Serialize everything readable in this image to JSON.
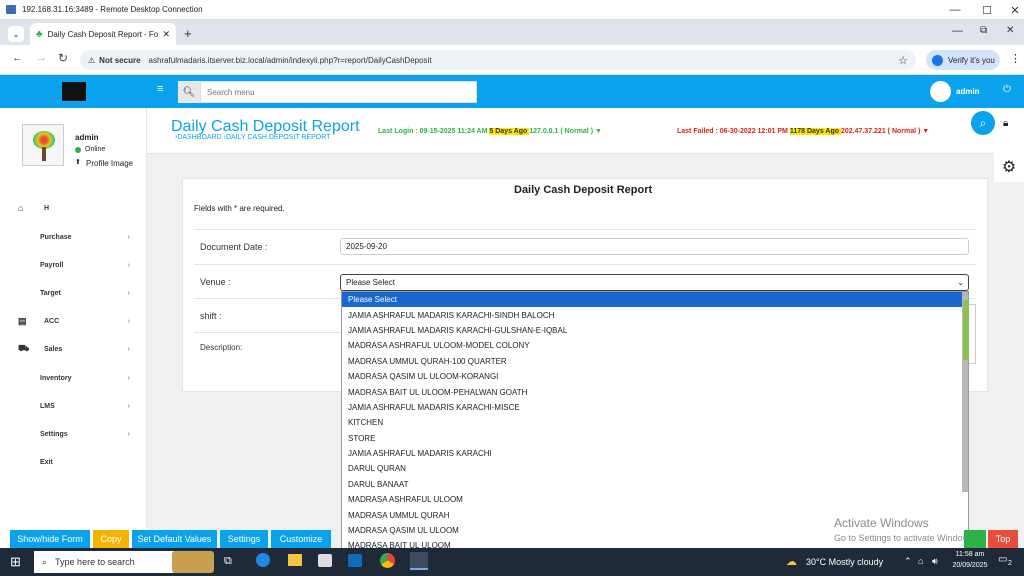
{
  "rdp": {
    "title": "192.168.31.16:3489 - Remote Desktop Connection"
  },
  "browser": {
    "tab_title": "Daily Cash Deposit Report - Fo",
    "not_secure": "Not secure",
    "url": "ashrafulmadaris.itserver.biz.local/admin/indexyii.php?r=report/DailyCashDeposit",
    "verify_label": "Verify it's you"
  },
  "topbar": {
    "search_placeholder": "Search menu",
    "user": "admin"
  },
  "profile": {
    "name": "admin",
    "status": "Online",
    "profile_image": "Profile Image"
  },
  "nav": [
    "H",
    "Purchase",
    "Payroll",
    "Target",
    "ACC",
    "Sales",
    "Inventory",
    "LMS",
    "Settings",
    "Exit"
  ],
  "header": {
    "title": "Daily Cash Deposit Report",
    "breadcrumb": "›DASHBOARD  ›DAILY CASH DEPOSIT REPORT",
    "last_login": "Last Login : 09-15-2025 11:24 AM",
    "last_login_ago": " 5 Days Ago ",
    "last_login_ip": "127.0.0.1 ( Normal ) ▼",
    "last_failed": "Last Failed : 06-30-2022 12:01 PM",
    "last_failed_ago": " 1178 Days Ago ",
    "last_failed_ip": "202.47.37.221 ( Normal ) ▼"
  },
  "form": {
    "title": "Daily Cash Deposit Report",
    "required_note": "Fields with * are required.",
    "doc_date_label": "Document Date :",
    "doc_date_value": "2025-09-20",
    "venue_label": "Venue :",
    "venue_value": "Please Select",
    "shift_label": "shift :",
    "description_label": "Description:"
  },
  "venue_options": [
    "Please Select",
    "JAMIA ASHRAFUL MADARIS KARACHI-SINDH BALOCH",
    "JAMIA ASHRAFUL MADARIS KARACHI-GULSHAN-E-IQBAL",
    "MADRASA ASHRAFUL ULOOM-MODEL COLONY",
    "MADRASA UMMUL QURAH-100 QUARTER",
    "MADRASA QASIM UL ULOOM-KORANGI",
    "MADRASA BAIT UL ULOOM-PEHALWAN GOATH",
    "JAMIA ASHRAFUL MADARIS KARACHI-MISCE",
    "KITCHEN",
    "STORE",
    "JAMIA ASHRAFUL MADARIS KARACHI",
    "DARUL QURAN",
    "DARUL BANAAT",
    "MADRASA ASHRAFUL ULOOM",
    "MADRASA UMMUL QURAH",
    "MADRASA QASIM UL ULOOM",
    "MADRASA BAIT UL ULOOM"
  ],
  "buttons": {
    "show_hide": "Show/hide Form",
    "copy": "Copy",
    "default_values": "Set Default Values",
    "settings": "Settings",
    "customize": "Customize",
    "top": "Top"
  },
  "watermark": {
    "line1": "Activate Windows",
    "line2": "Go to Settings to activate Windows."
  },
  "taskbar": {
    "search": "Type here to search",
    "weather": "30°C  Mostly cloudy",
    "time": "11:58 am",
    "date": "20/09/2025",
    "notif": "2"
  },
  "colors": {
    "accent": "#0aa2ec",
    "select": "#1967d2",
    "green": "#2db24a",
    "red": "#e0201b"
  }
}
